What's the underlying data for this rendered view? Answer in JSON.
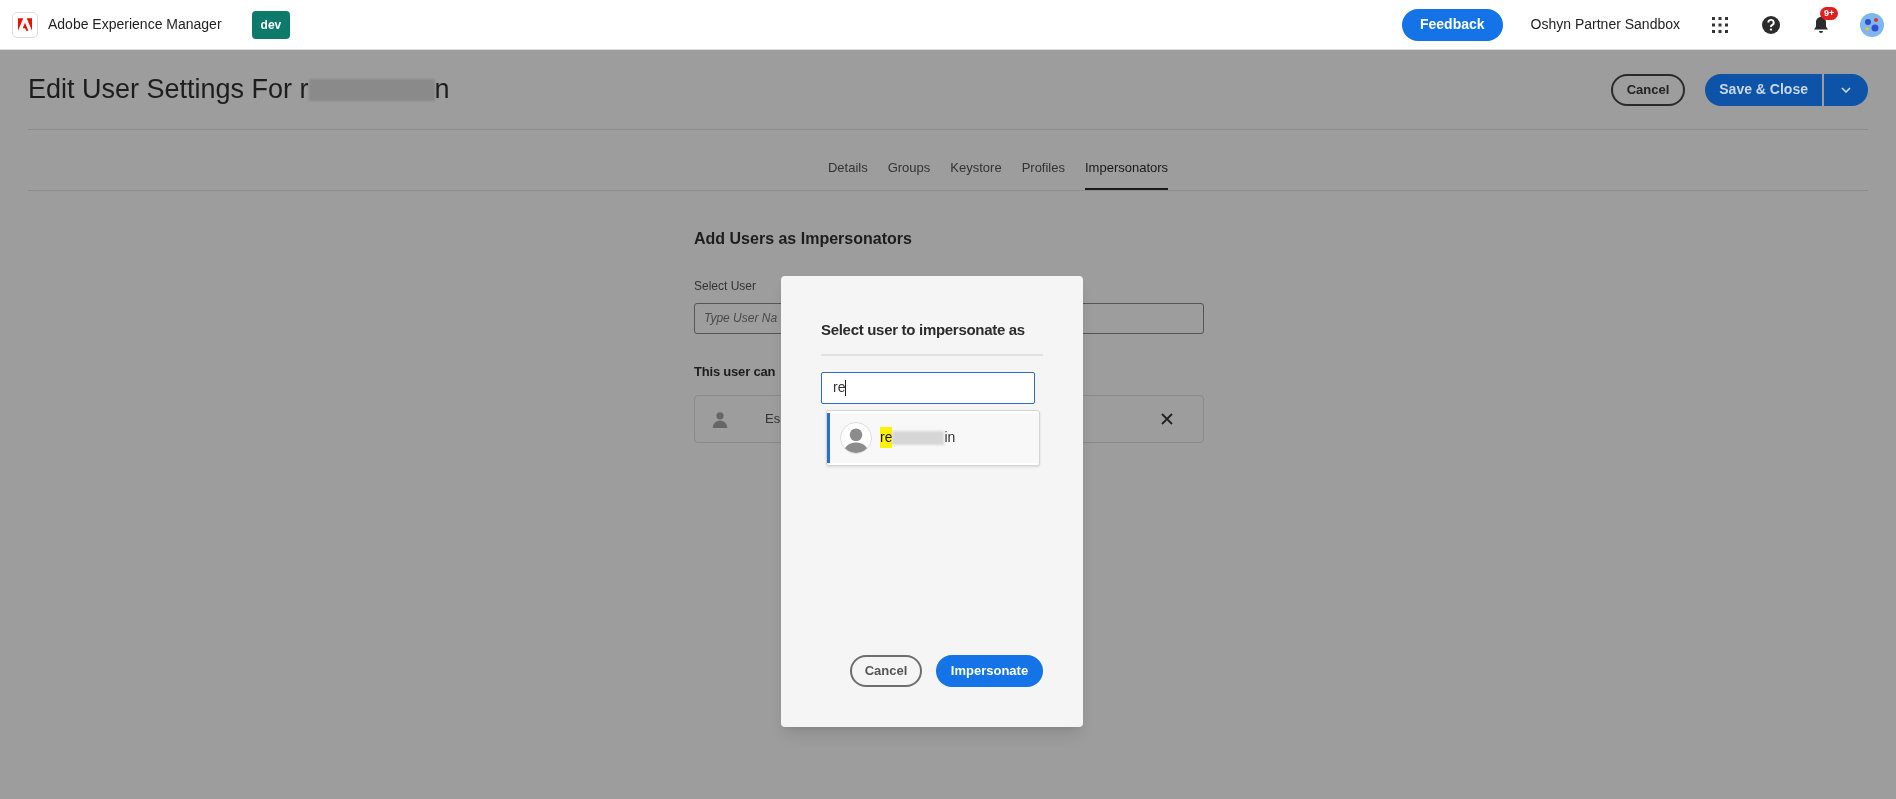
{
  "app": {
    "name": "Adobe Experience Manager",
    "env_badge": "dev"
  },
  "header": {
    "feedback": "Feedback",
    "org": "Oshyn Partner Sandbox",
    "notification_count": "9+"
  },
  "page": {
    "title_start": "Edit User Settings For r",
    "title_end": "n",
    "cancel": "Cancel",
    "save": "Save & Close"
  },
  "tabs": [
    {
      "label": "Details",
      "selected": false
    },
    {
      "label": "Groups",
      "selected": false
    },
    {
      "label": "Keystore",
      "selected": false
    },
    {
      "label": "Profiles",
      "selected": false
    },
    {
      "label": "Impersonators",
      "selected": true
    }
  ],
  "section": {
    "heading": "Add Users as Impersonators",
    "select_label": "Select User",
    "placeholder": "Type User Na",
    "list_heading": "This user can",
    "impersonator_name": "Es"
  },
  "dialog": {
    "title": "Select user to impersonate as",
    "search_value": "re",
    "results": [
      {
        "match": "re",
        "rest": "in",
        "selected": true
      }
    ],
    "cancel": "Cancel",
    "confirm": "Impersonate"
  }
}
